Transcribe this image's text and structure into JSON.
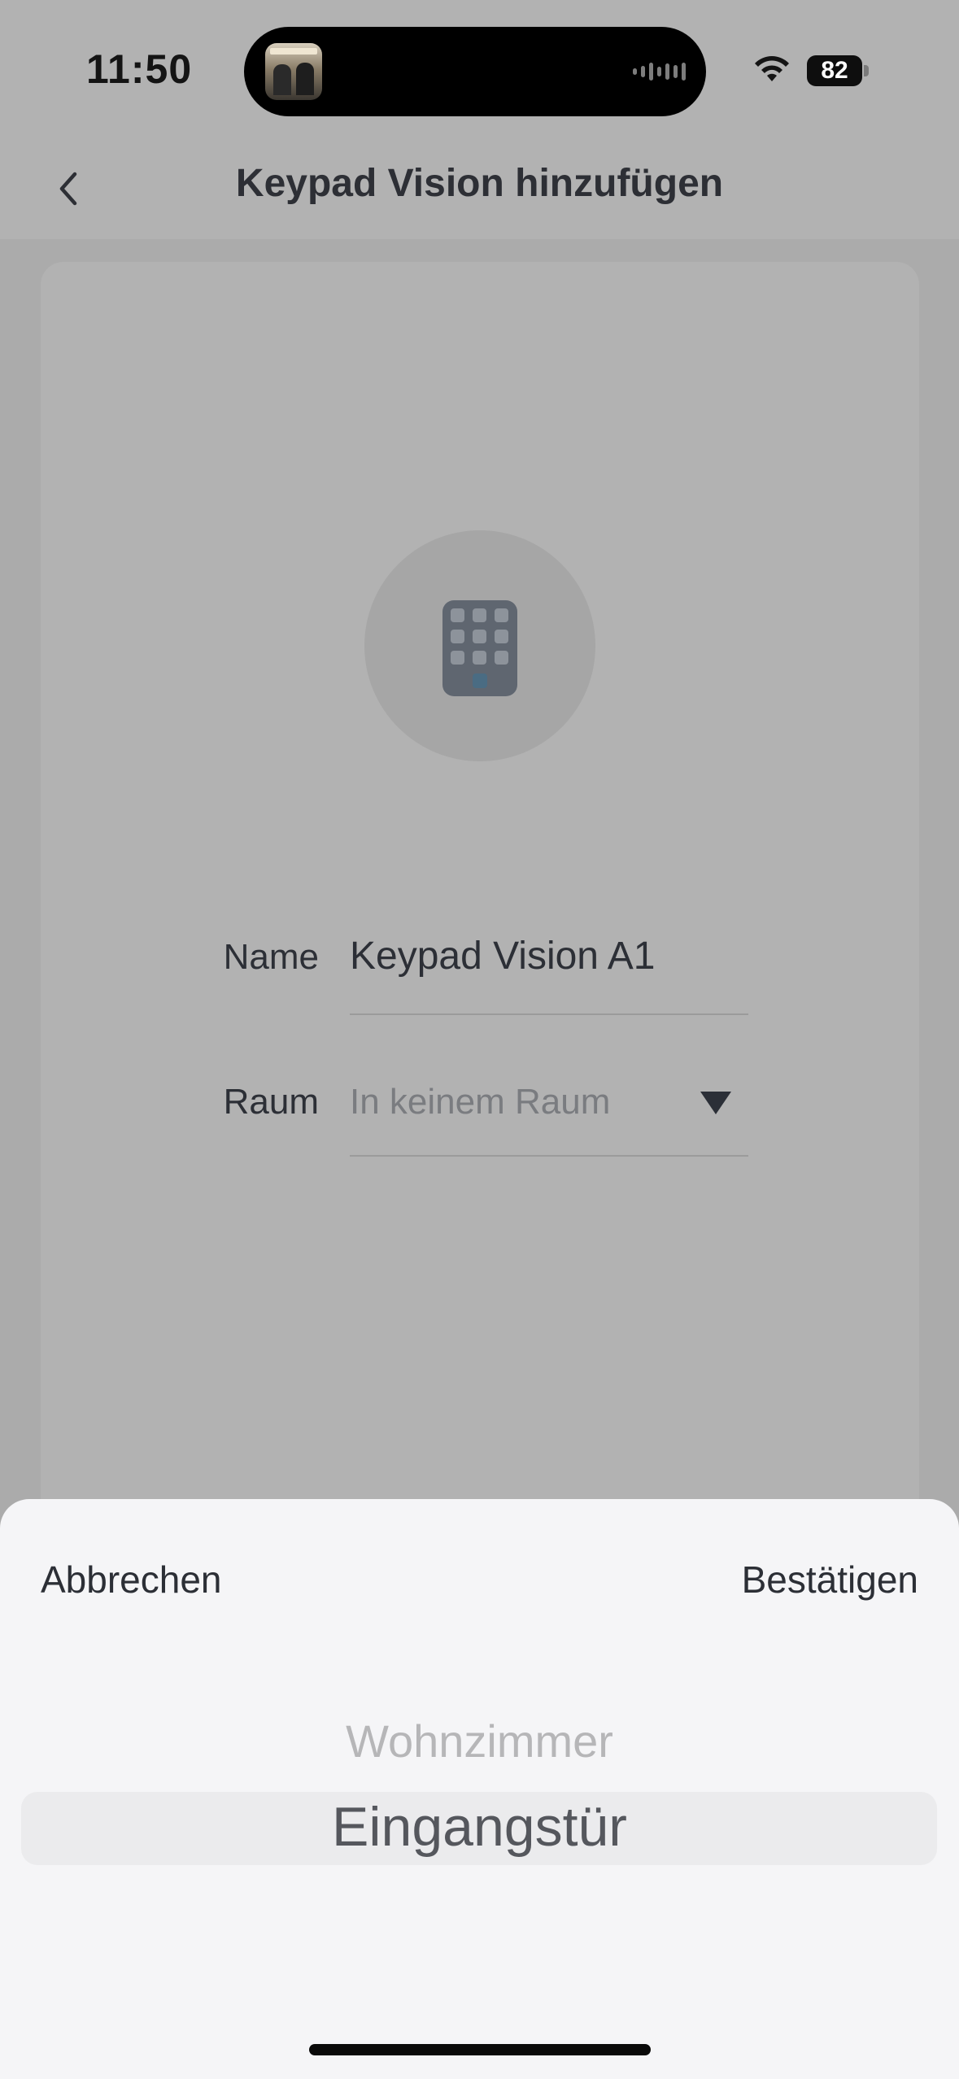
{
  "status_bar": {
    "time": "11:50",
    "battery": "82",
    "icons": [
      "album-art-icon",
      "audio-waveform-icon",
      "wifi-icon",
      "battery-icon"
    ]
  },
  "nav": {
    "title": "Keypad Vision hinzufügen",
    "back_icon": "chevron-left-icon"
  },
  "device": {
    "icon": "keypad-icon"
  },
  "form": {
    "name_label": "Name",
    "name_value": "Keypad Vision A1",
    "room_label": "Raum",
    "room_value": "In keinem Raum",
    "room_dropdown_icon": "triangle-down-icon"
  },
  "picker": {
    "cancel": "Abbrechen",
    "confirm": "Bestätigen",
    "options": [
      "Wohnzimmer",
      "Eingangstür"
    ],
    "selected": "Eingangstür"
  },
  "colors": {
    "overlay_background": "#ababab",
    "sheet_background": "#f5f5f7",
    "text_primary": "#2c2f36",
    "keypad_body": "#5f6670",
    "keypad_accent": "#4a6c83"
  }
}
